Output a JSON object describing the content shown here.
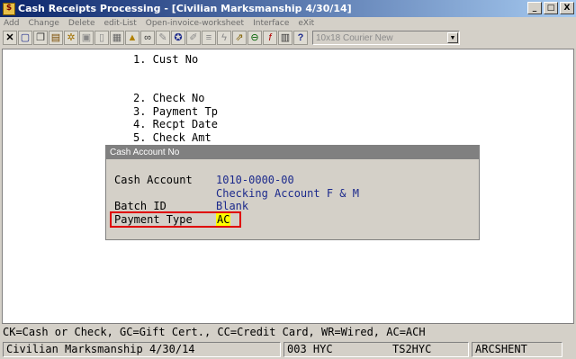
{
  "window": {
    "title": "Cash Receipts Processing - [Civilian Marksmanship 4/30/14]",
    "minimize": "_",
    "maximize": "□",
    "close": "X"
  },
  "menu": [
    "Add",
    "Change",
    "Delete",
    "edit-List",
    "Open-invoice-worksheet",
    "Interface",
    "eXit"
  ],
  "toolbar": {
    "font_select": "10x18 Courier New"
  },
  "form": {
    "fields": [
      "1. Cust No",
      "2. Check No",
      "3. Payment Tp",
      "4. Recpt Date",
      "5. Check Amt"
    ]
  },
  "dialog": {
    "title": "Cash Account No",
    "cash_account_label": "Cash Account",
    "cash_account_value": "1010-0000-00",
    "cash_account_desc": "Checking Account F & M",
    "batch_label": "Batch ID",
    "batch_value": "Blank",
    "payment_type_label": "Payment Type",
    "payment_type_value": "AC"
  },
  "hint": "CK=Cash or Check, GC=Gift Cert., CC=Credit Card, WR=Wired, AC=ACH",
  "status": {
    "company": "Civilian Marksmanship 4/30/14",
    "code": "003 HYC",
    "terminal": "TS2HYC",
    "user": "ARCSHENT"
  }
}
